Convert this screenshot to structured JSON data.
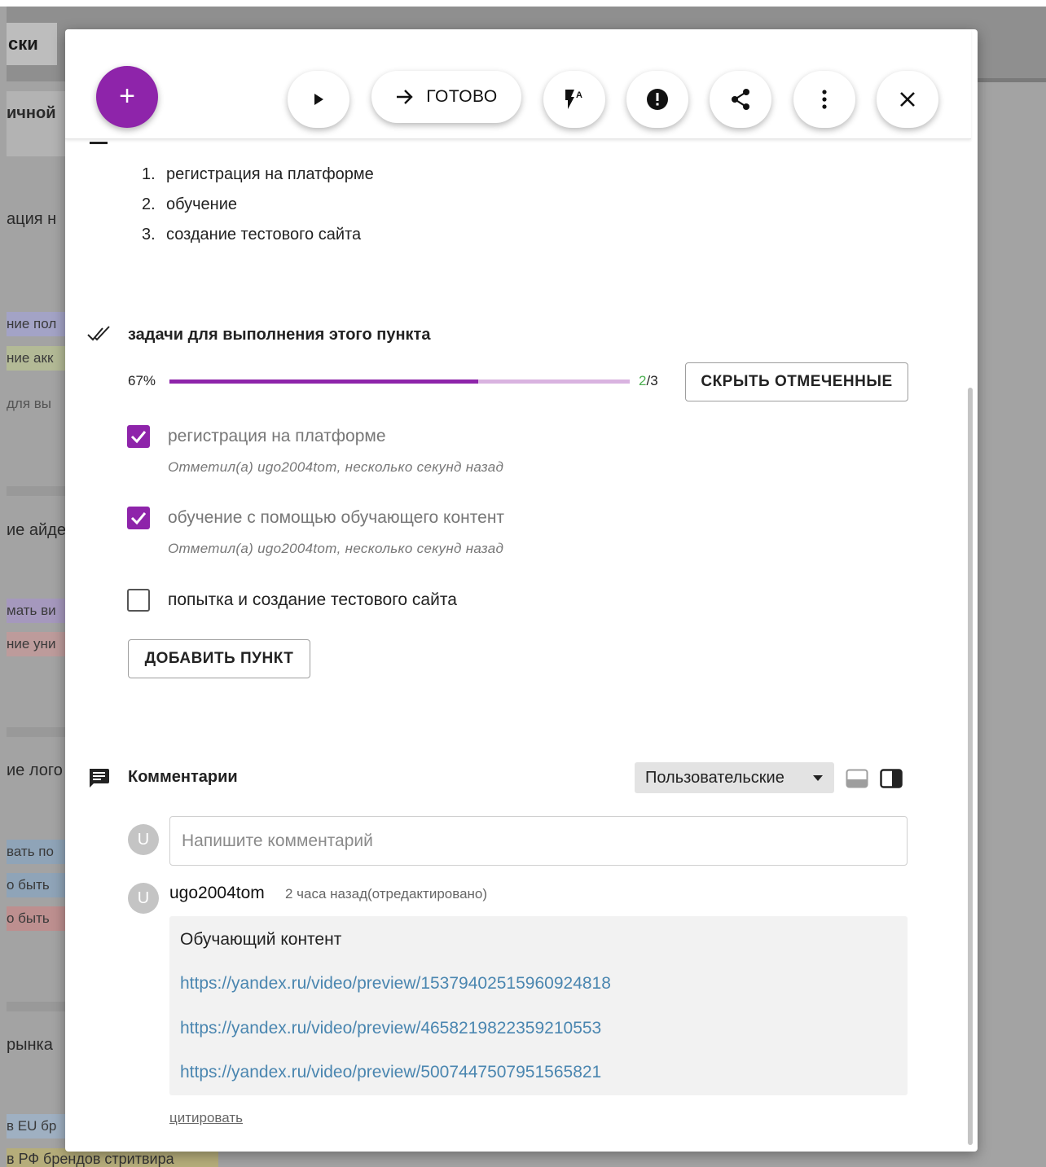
{
  "background": {
    "board_title": "ски",
    "card_texts": [
      "ичной",
      "ация н",
      "ие айде",
      "ие лого",
      "рынка"
    ],
    "chips": [
      "ние пол",
      "ние акк",
      "для вы",
      "мать ви",
      "ние уни",
      "вать по",
      "о быть",
      "о быть",
      "в EU бр"
    ],
    "bottom_chip": "в РФ брендов стритвира"
  },
  "toolbar": {
    "add_label": "+",
    "done_label": "ГОТОВО"
  },
  "description": {
    "items": [
      {
        "num": "1.",
        "text": "регистрация на платформе"
      },
      {
        "num": "2.",
        "text": "обучение"
      },
      {
        "num": "3.",
        "text": "создание тестового сайта"
      }
    ]
  },
  "checklist": {
    "title": "задачи для выполнения этого пункта",
    "percent_label": "67%",
    "progress_fraction": 0.67,
    "count_done": "2",
    "count_total": "/3",
    "hide_checked_label": "СКРЫТЬ ОТМЕЧЕННЫЕ",
    "items": [
      {
        "label": "регистрация на платформе",
        "checked": true,
        "meta": "Отметил(а) ugo2004tom, несколько секунд назад"
      },
      {
        "label": "обучение с помощью обучающего контент",
        "checked": true,
        "meta": "Отметил(а) ugo2004tom, несколько секунд назад"
      },
      {
        "label": "попытка и создание тестового сайта",
        "checked": false,
        "meta": ""
      }
    ],
    "add_item_label": "ДОБАВИТЬ ПУНКТ"
  },
  "comments": {
    "title": "Комментарии",
    "filter_selected": "Пользовательские",
    "input_avatar": "U",
    "input_placeholder": "Напишите комментарий",
    "list": [
      {
        "avatar": "U",
        "author": "ugo2004tom",
        "time": "2 часа назад(отредактировано)",
        "text": "Обучающий контент",
        "links": [
          "https://yandex.ru/video/preview/15379402515960924818",
          "https://yandex.ru/video/preview/4658219822359210553",
          "https://yandex.ru/video/preview/5007447507951565821"
        ],
        "quote_label": "цитировать"
      }
    ]
  },
  "colors": {
    "accent": "#8e24aa",
    "accent_light": "#d9b3e0",
    "done_count": "#4caf50",
    "link": "#4a86b0"
  }
}
